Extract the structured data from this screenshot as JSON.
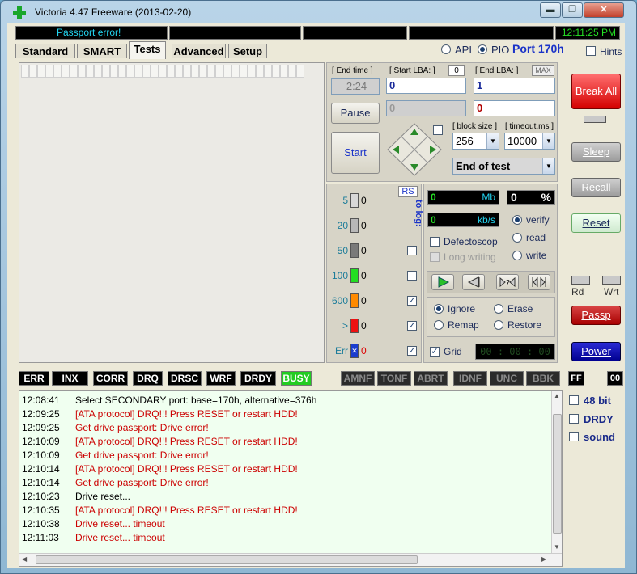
{
  "window": {
    "title": "Victoria 4.47  Freeware (2013-02-20)",
    "minimize": "▬",
    "maximize": "❐",
    "close": "✕"
  },
  "status": {
    "message": "Passport error!",
    "time": "12:11:25 PM"
  },
  "tabs": [
    {
      "label": "Standard"
    },
    {
      "label": "SMART"
    },
    {
      "label": "Tests"
    },
    {
      "label": "Advanced"
    },
    {
      "label": "Setup"
    }
  ],
  "mode": {
    "api_label": "API",
    "pio_label": "PIO",
    "port": "Port 170h",
    "hints_label": "Hints"
  },
  "test_panel": {
    "end_time_label": "[ End time ]",
    "end_time_value": "2:24",
    "start_lba_label": "[ Start LBA: ]",
    "start_lba_counter": "0",
    "end_lba_label": "[ End LBA: ]",
    "max_label": "MAX",
    "start_lba_value": "0",
    "end_lba_value": "1",
    "current_lba_value": "0",
    "current_end_value": "0",
    "pause_label": "Pause",
    "start_label": "Start",
    "block_size_label": "[ block size ]",
    "timeout_label": "[ timeout,ms ]",
    "block_size_value": "256",
    "timeout_value": "10000",
    "end_action_value": "End of test"
  },
  "stats": {
    "rs_label": "RS",
    "to_log_label": "to log:",
    "rows": [
      {
        "label": "5",
        "count": "0",
        "color": "#d8d8d8",
        "log": false
      },
      {
        "label": "20",
        "count": "0",
        "color": "#b8b8b8",
        "log": false
      },
      {
        "label": "50",
        "count": "0",
        "color": "#7a7a7a",
        "log": false
      },
      {
        "label": "100",
        "count": "0",
        "color": "#22dd22",
        "log": false
      },
      {
        "label": "600",
        "count": "0",
        "color": "#ff8a00",
        "log": true
      },
      {
        "label": ">",
        "count": "0",
        "color": "#ee1111",
        "log": true
      },
      {
        "label": "Err",
        "count": "0",
        "color": "#1a3ccf",
        "log": true
      }
    ]
  },
  "speed": {
    "mb_value": "0",
    "mb_unit": "Mb",
    "percent_value": "0",
    "percent_unit": "%",
    "kbs_value": "0",
    "kbs_unit": "kb/s",
    "verify_label": "verify",
    "read_label": "read",
    "write_label": "write",
    "defectoscop_label": "Defectoscop",
    "long_writing_label": "Long writing",
    "ignore_label": "Ignore",
    "erase_label": "Erase",
    "remap_label": "Remap",
    "restore_label": "Restore",
    "grid_label": "Grid",
    "grid_time": "00 : 00 : 00"
  },
  "side": {
    "break_all": "Break All",
    "sleep": "Sleep",
    "recall": "Recall",
    "reset": "Reset",
    "rd": "Rd",
    "wrt": "Wrt",
    "passp": "Passp",
    "power": "Power"
  },
  "flags": {
    "left": [
      "ERR",
      "INX",
      "CORR",
      "DRQ",
      "DRSC",
      "WRF",
      "DRDY",
      "BUSY"
    ],
    "right": [
      "AMNF",
      "TONF",
      "ABRT",
      "IDNF",
      "UNC",
      "BBK"
    ],
    "ff": "FF",
    "hex": "00"
  },
  "log": [
    {
      "time": "12:08:41",
      "msg": "Select SECONDARY port: base=170h, alternative=376h",
      "color": "#000000"
    },
    {
      "time": "12:09:25",
      "msg": "[ATA protocol] DRQ!!! Press RESET or restart HDD!",
      "color": "#cc0000"
    },
    {
      "time": "12:09:25",
      "msg": "Get drive passport: Drive error!",
      "color": "#cc0000"
    },
    {
      "time": "12:10:09",
      "msg": "[ATA protocol] DRQ!!! Press RESET or restart HDD!",
      "color": "#cc0000"
    },
    {
      "time": "12:10:09",
      "msg": "Get drive passport: Drive error!",
      "color": "#cc0000"
    },
    {
      "time": "12:10:14",
      "msg": "[ATA protocol] DRQ!!! Press RESET or restart HDD!",
      "color": "#cc0000"
    },
    {
      "time": "12:10:14",
      "msg": "Get drive passport: Drive error!",
      "color": "#cc0000"
    },
    {
      "time": "12:10:23",
      "msg": "Drive reset...",
      "color": "#000000"
    },
    {
      "time": "12:10:35",
      "msg": "[ATA protocol] DRQ!!! Press RESET or restart HDD!",
      "color": "#cc0000"
    },
    {
      "time": "12:10:38",
      "msg": "Drive reset... timeout",
      "color": "#cc0000"
    },
    {
      "time": "12:11:03",
      "msg": "Drive reset... timeout",
      "color": "#cc0000"
    }
  ],
  "options": {
    "bit48_label": "48 bit",
    "drdy_label": "DRDY",
    "sound_label": "sound"
  }
}
